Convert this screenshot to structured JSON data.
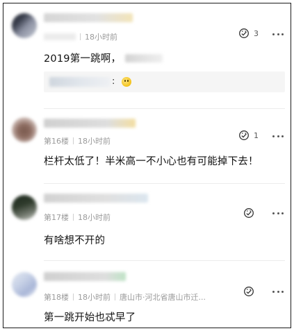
{
  "comments": [
    {
      "floor": "",
      "time": "18小时前",
      "location": "",
      "like_count": "3",
      "text": "2019第一跳啊，",
      "reply": {
        "colon": ":"
      }
    },
    {
      "floor": "第16楼",
      "time": "18小时前",
      "location": "",
      "like_count": "1",
      "text": "栏杆太低了！半米高一不小心也有可能掉下去！"
    },
    {
      "floor": "第17楼",
      "time": "18小时前",
      "location": "",
      "like_count": "",
      "text": "有啥想不开的"
    },
    {
      "floor": "第18楼",
      "time": "18小时前",
      "location": "唐山市·河北省唐山市迁...",
      "like_count": "",
      "text": "第一跳开始也忒早了"
    }
  ],
  "icons": {
    "like": "like-icon",
    "more": "more-icon",
    "emoji": "emoji-icon"
  },
  "colors": {
    "meta_text": "#9a9a9a",
    "content_text": "#111111",
    "reply_bg": "#f5f5f5"
  }
}
